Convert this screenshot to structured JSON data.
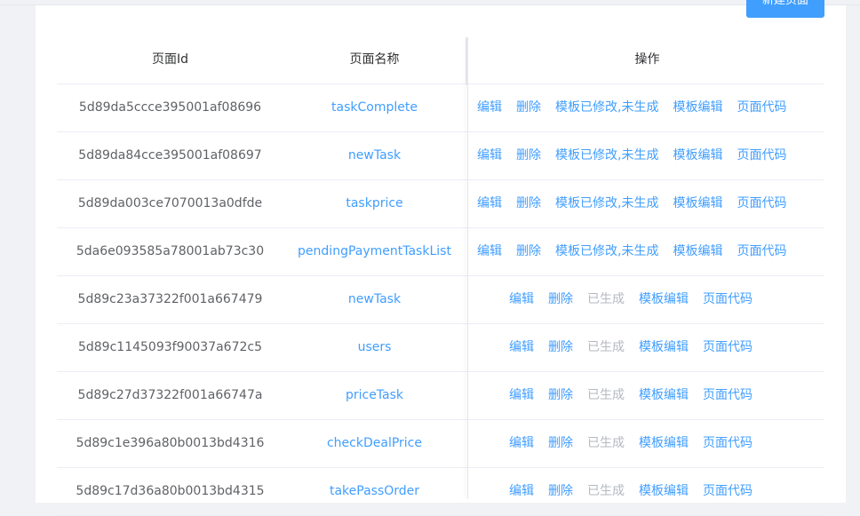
{
  "toolbar": {
    "new_page_label": "新建页面"
  },
  "table": {
    "headers": {
      "id": "页面Id",
      "name": "页面名称",
      "ops": "操作"
    },
    "rows": [
      {
        "id": "5d89da5ccce395001af08696",
        "name": "taskComplete",
        "ops": [
          "编辑",
          "删除",
          "模板已修改,未生成",
          "模板编辑",
          "页面代码"
        ]
      },
      {
        "id": "5d89da84cce395001af08697",
        "name": "newTask",
        "ops": [
          "编辑",
          "删除",
          "模板已修改,未生成",
          "模板编辑",
          "页面代码"
        ]
      },
      {
        "id": "5d89da003ce7070013a0dfde",
        "name": "taskprice",
        "ops": [
          "编辑",
          "删除",
          "模板已修改,未生成",
          "模板编辑",
          "页面代码"
        ]
      },
      {
        "id": "5da6e093585a78001ab73c30",
        "name": "pendingPaymentTaskList",
        "ops": [
          "编辑",
          "删除",
          "模板已修改,未生成",
          "模板编辑",
          "页面代码"
        ]
      },
      {
        "id": "5d89c23a37322f001a667479",
        "name": "newTask",
        "ops": [
          "编辑",
          "删除",
          "已生成",
          "模板编辑",
          "页面代码"
        ]
      },
      {
        "id": "5d89c1145093f90037a672c5",
        "name": "users",
        "ops": [
          "编辑",
          "删除",
          "已生成",
          "模板编辑",
          "页面代码"
        ]
      },
      {
        "id": "5d89c27d37322f001a66747a",
        "name": "priceTask",
        "ops": [
          "编辑",
          "删除",
          "已生成",
          "模板编辑",
          "页面代码"
        ]
      },
      {
        "id": "5d89c1e396a80b0013bd4316",
        "name": "checkDealPrice",
        "ops": [
          "编辑",
          "删除",
          "已生成",
          "模板编辑",
          "页面代码"
        ]
      },
      {
        "id": "5d89c17d36a80b0013bd4315",
        "name": "takePassOrder",
        "ops": [
          "编辑",
          "删除",
          "已生成",
          "模板编辑",
          "页面代码"
        ]
      }
    ]
  }
}
